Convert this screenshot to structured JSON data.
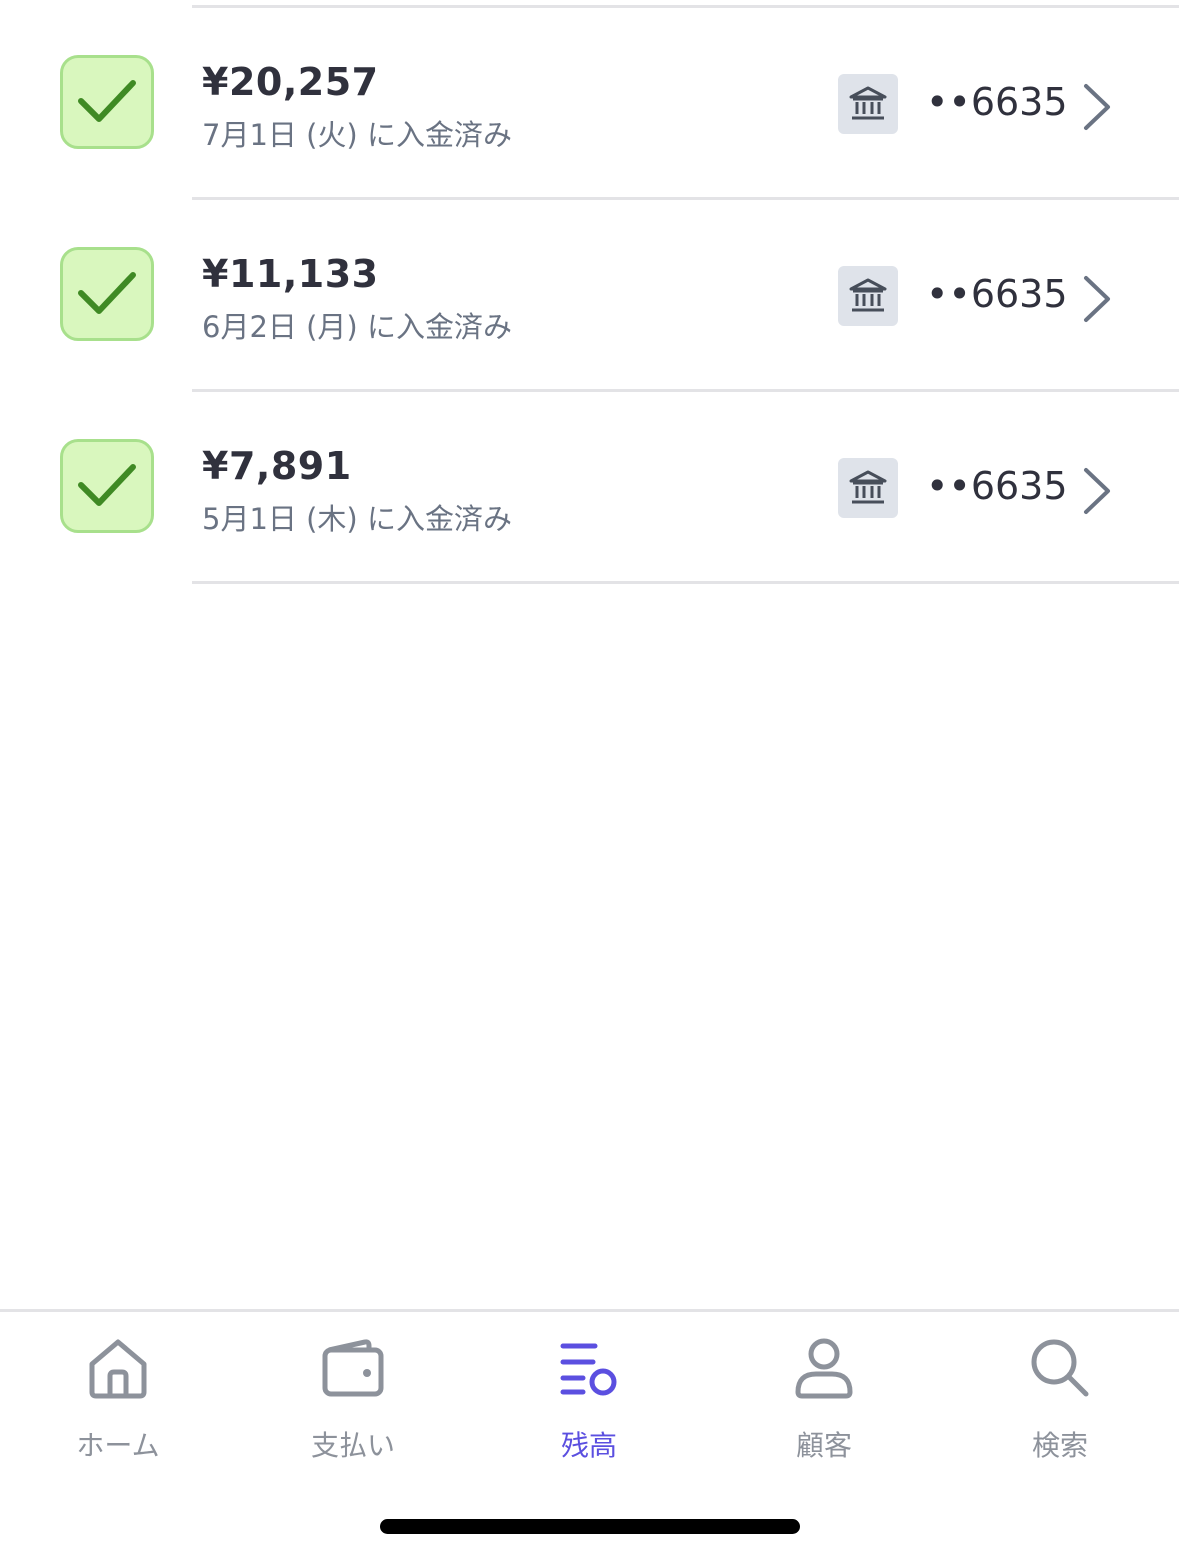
{
  "payouts": [
    {
      "amount": "¥20,257",
      "status": "7月1日 (火) に入金済み",
      "account": "••6635"
    },
    {
      "amount": "¥11,133",
      "status": "6月2日 (月) に入金済み",
      "account": "••6635"
    },
    {
      "amount": "¥7,891",
      "status": "5月1日 (木) に入金済み",
      "account": "••6635"
    }
  ],
  "tabbar": {
    "home": "ホーム",
    "payments": "支払い",
    "balances": "残高",
    "customers": "顧客",
    "search": "検索"
  },
  "icons": {
    "status": "checkmark-icon",
    "destination": "bank-icon",
    "navigate": "chevron-right-icon"
  },
  "colors": {
    "accent": "#5b4fe0",
    "success_bg": "#d9f7be",
    "success_check": "#3f8a24",
    "inactive": "#8d929b"
  }
}
